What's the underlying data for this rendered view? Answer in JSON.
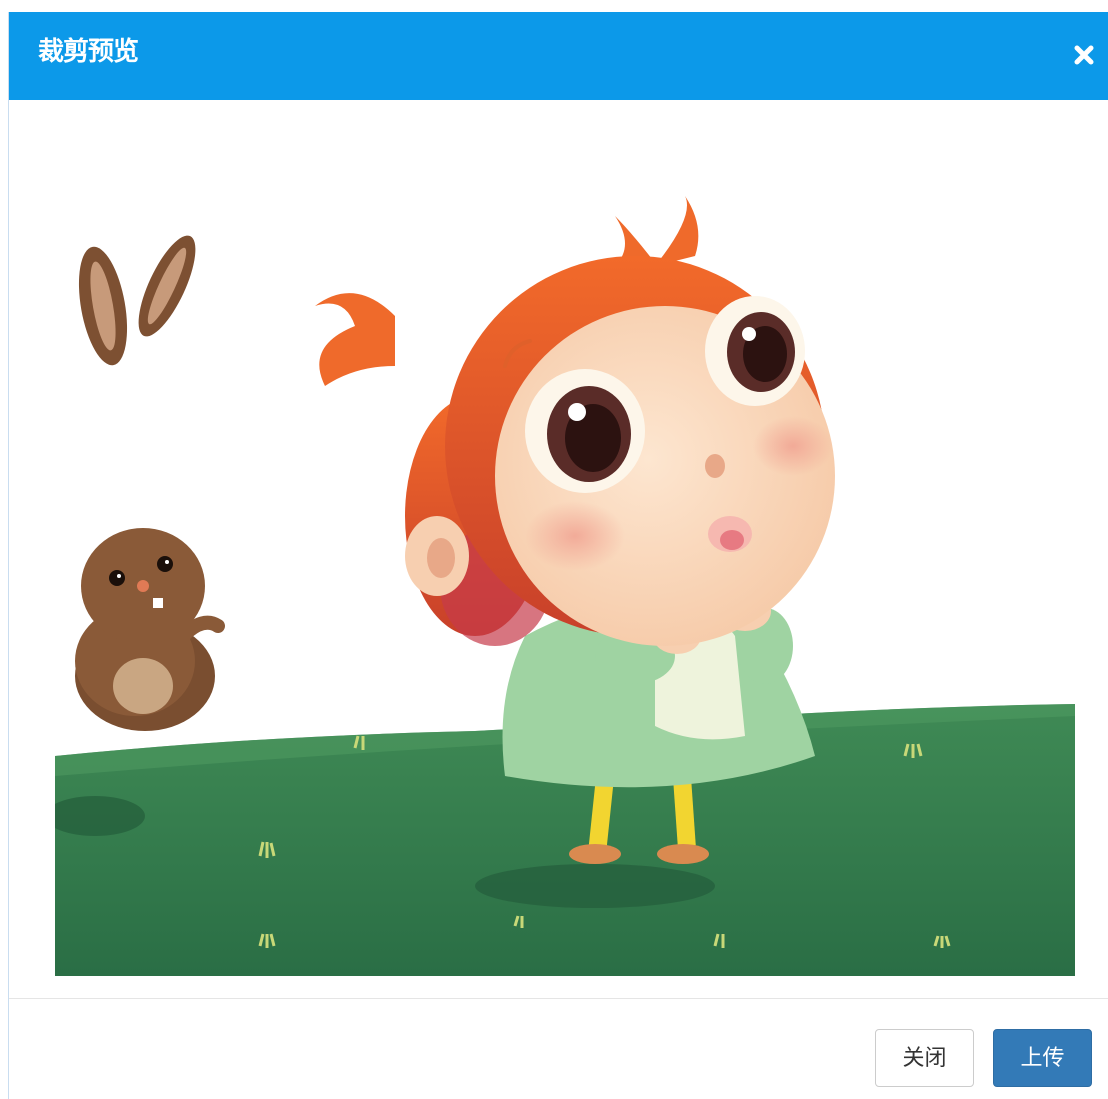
{
  "dialog": {
    "title": "裁剪预览",
    "close_icon": "close-icon",
    "preview_image": "cropped-illustration-girl-and-bunny-on-grass"
  },
  "footer": {
    "close_label": "关闭",
    "upload_label": "上传"
  },
  "colors": {
    "header": "#0c99e9",
    "primary_button": "#337ab7",
    "default_button_border": "#cccccc"
  }
}
